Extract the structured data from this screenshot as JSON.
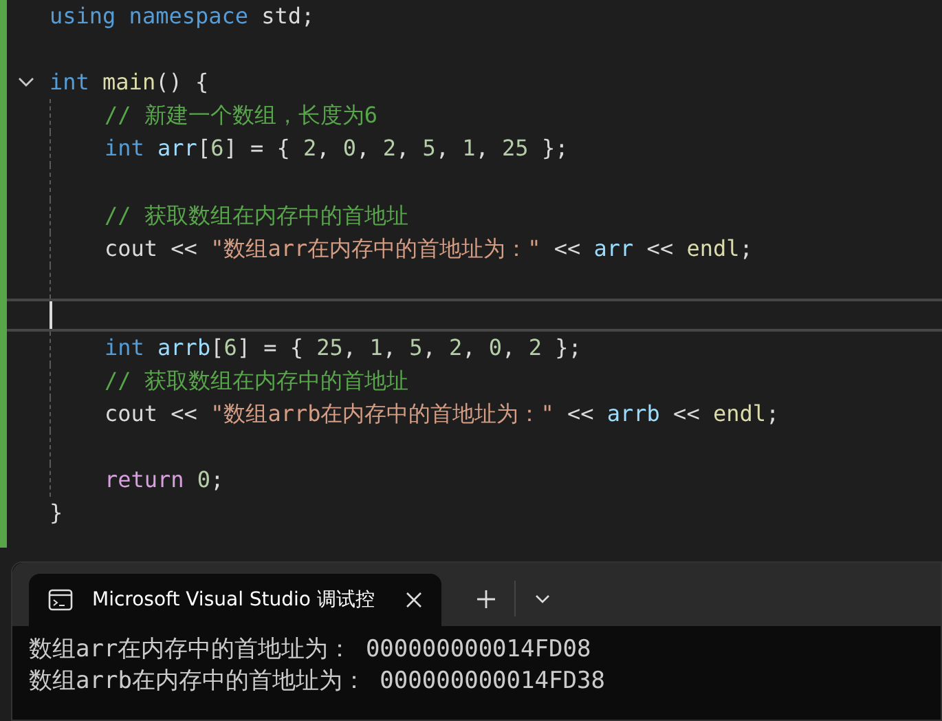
{
  "editor": {
    "lines": [
      {
        "kind": "code",
        "current": false,
        "tokens": [
          {
            "kind": "keyword",
            "text": "using"
          },
          {
            "kind": "keyword",
            "text": " namespace"
          },
          {
            "kind": "plain",
            "text": " std;"
          }
        ]
      },
      {
        "kind": "blank",
        "current": false
      },
      {
        "kind": "block-start",
        "current": false,
        "tokens": [
          {
            "kind": "keyword",
            "text": "int"
          },
          {
            "kind": "function",
            "text": " main"
          },
          {
            "kind": "plain",
            "text": "() {"
          }
        ],
        "children": [
          {
            "kind": "code",
            "current": false,
            "tokens": [
              {
                "kind": "comment",
                "text": "// 新建一个数组，长度为6"
              }
            ]
          },
          {
            "kind": "code",
            "current": false,
            "tokens": [
              {
                "kind": "keyword",
                "text": "int"
              },
              {
                "kind": "variable",
                "text": " arr"
              },
              {
                "kind": "plain",
                "text": "["
              },
              {
                "kind": "number",
                "text": "6"
              },
              {
                "kind": "plain",
                "text": "] = { "
              },
              {
                "kind": "number",
                "text": "2"
              },
              {
                "kind": "plain",
                "text": ", "
              },
              {
                "kind": "number",
                "text": "0"
              },
              {
                "kind": "plain",
                "text": ", "
              },
              {
                "kind": "number",
                "text": "2"
              },
              {
                "kind": "plain",
                "text": ", "
              },
              {
                "kind": "number",
                "text": "5"
              },
              {
                "kind": "plain",
                "text": ", "
              },
              {
                "kind": "number",
                "text": "1"
              },
              {
                "kind": "plain",
                "text": ", "
              },
              {
                "kind": "number",
                "text": "25"
              },
              {
                "kind": "plain",
                "text": " };"
              }
            ]
          },
          {
            "kind": "blank",
            "current": false
          },
          {
            "kind": "code",
            "current": false,
            "tokens": [
              {
                "kind": "comment",
                "text": "// 获取数组在内存中的首地址"
              }
            ]
          },
          {
            "kind": "code",
            "current": false,
            "tokens": [
              {
                "kind": "plain",
                "text": "cout << "
              },
              {
                "kind": "string",
                "text": "\"数组arr在内存中的首地址为：\""
              },
              {
                "kind": "plain",
                "text": " << "
              },
              {
                "kind": "variable",
                "text": "arr"
              },
              {
                "kind": "plain",
                "text": " << "
              },
              {
                "kind": "function",
                "text": "endl"
              },
              {
                "kind": "plain",
                "text": ";"
              }
            ]
          },
          {
            "kind": "blank",
            "current": false
          },
          {
            "kind": "blank",
            "current": true
          },
          {
            "kind": "code",
            "current": false,
            "tokens": [
              {
                "kind": "keyword",
                "text": "int"
              },
              {
                "kind": "variable",
                "text": " arrb"
              },
              {
                "kind": "plain",
                "text": "["
              },
              {
                "kind": "number",
                "text": "6"
              },
              {
                "kind": "plain",
                "text": "] = { "
              },
              {
                "kind": "number",
                "text": "25"
              },
              {
                "kind": "plain",
                "text": ", "
              },
              {
                "kind": "number",
                "text": "1"
              },
              {
                "kind": "plain",
                "text": ", "
              },
              {
                "kind": "number",
                "text": "5"
              },
              {
                "kind": "plain",
                "text": ", "
              },
              {
                "kind": "number",
                "text": "2"
              },
              {
                "kind": "plain",
                "text": ", "
              },
              {
                "kind": "number",
                "text": "0"
              },
              {
                "kind": "plain",
                "text": ", "
              },
              {
                "kind": "number",
                "text": "2"
              },
              {
                "kind": "plain",
                "text": " };"
              }
            ]
          },
          {
            "kind": "code",
            "current": false,
            "tokens": [
              {
                "kind": "comment",
                "text": "// 获取数组在内存中的首地址"
              }
            ]
          },
          {
            "kind": "code",
            "current": false,
            "tokens": [
              {
                "kind": "plain",
                "text": "cout << "
              },
              {
                "kind": "string",
                "text": "\"数组arrb在内存中的首地址为：\""
              },
              {
                "kind": "plain",
                "text": " << "
              },
              {
                "kind": "variable",
                "text": "arrb"
              },
              {
                "kind": "plain",
                "text": " << "
              },
              {
                "kind": "function",
                "text": "endl"
              },
              {
                "kind": "plain",
                "text": ";"
              }
            ]
          },
          {
            "kind": "blank",
            "current": false
          },
          {
            "kind": "code",
            "current": false,
            "tokens": [
              {
                "kind": "control",
                "text": "return"
              },
              {
                "kind": "number",
                "text": " 0"
              },
              {
                "kind": "plain",
                "text": ";"
              }
            ]
          }
        ]
      },
      {
        "kind": "code",
        "current": false,
        "tokens": [
          {
            "kind": "plain",
            "text": "}"
          }
        ]
      }
    ]
  },
  "terminal": {
    "tabs": [
      {
        "title": "Microsoft Visual Studio 调试控",
        "selected": true
      }
    ],
    "output": [
      "数组arr在内存中的首地址为： 000000000014FD08",
      "数组arrb在内存中的首地址为： 000000000014FD38"
    ]
  }
}
